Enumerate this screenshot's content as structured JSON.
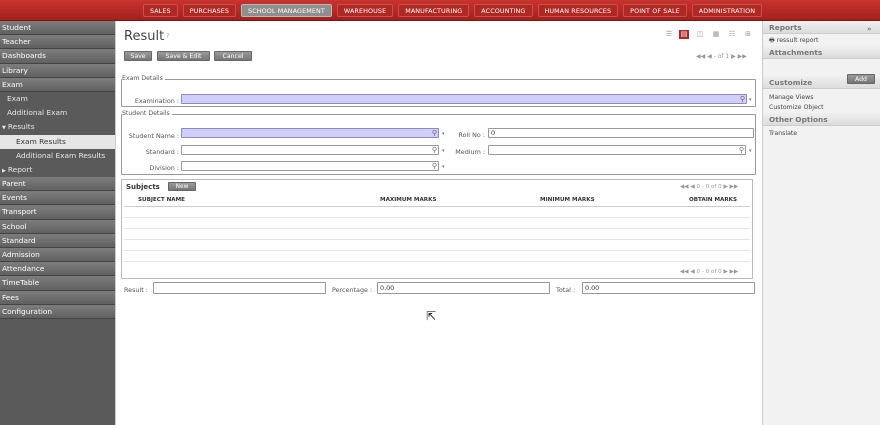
{
  "topnav": [
    "SALES",
    "PURCHASES",
    "SCHOOL MANAGEMENT",
    "WAREHOUSE",
    "MANUFACTURING",
    "ACCOUNTING",
    "HUMAN RESOURCES",
    "POINT OF SALE",
    "ADMINISTRATION"
  ],
  "sidebar": {
    "student": "Student",
    "teacher": "Teacher",
    "dashboards": "Dashboards",
    "library": "Library",
    "exam": "Exam",
    "exam_sub": "Exam",
    "additional_exam": "Additional Exam",
    "results": "Results",
    "exam_results": "Exam Results",
    "additional_exam_results": "Additional Exam Results",
    "report": "Report",
    "parent": "Parent",
    "events": "Events",
    "transport": "Transport",
    "school": "School",
    "standard": "Standard",
    "admission": "Admission",
    "attendance": "Attendance",
    "timetable": "TimeTable",
    "fees": "Fees",
    "configuration": "Configuration"
  },
  "page": {
    "title": "Result",
    "help": "?",
    "save": "Save",
    "save_edit": "Save & Edit",
    "cancel": "Cancel",
    "pager": "◀◀ ◀ - of 1 ▶ ▶▶"
  },
  "exam_details": {
    "legend": "Exam Details",
    "examination_label": "Examination :",
    "examination_value": ""
  },
  "student_details": {
    "legend": "Student Details",
    "student_name_label": "Student Name :",
    "student_name_value": "",
    "roll_no_label": "Roll No :",
    "roll_no_value": "0",
    "standard_label": "Standard :",
    "standard_value": "",
    "medium_label": "Medium :",
    "medium_value": "",
    "division_label": "Division :",
    "division_value": ""
  },
  "subjects": {
    "title": "Subjects",
    "new": "New",
    "pager_top": "◀◀ ◀ 0 - 0 of 0 ▶ ▶▶",
    "pager_bottom": "◀◀ ◀ 0 - 0 of 0 ▶ ▶▶",
    "columns": [
      "SUBJECT NAME",
      "MAXIMUM MARKS",
      "MINIMUM MARKS",
      "OBTAIN MARKS"
    ]
  },
  "totals": {
    "result_label": "Result :",
    "result_value": "",
    "percentage_label": "Percentage :",
    "percentage_value": "0.00",
    "total_label": "Total :",
    "total_value": "0.00"
  },
  "right": {
    "reports": "Reports",
    "ressult_report": "ressult report",
    "attachments": "Attachments",
    "add": "Add",
    "customize": "Customize",
    "manage_views": "Manage Views",
    "customize_object": "Customize Object",
    "other_options": "Other Options",
    "translate": "Translate",
    "collapse": "»"
  }
}
